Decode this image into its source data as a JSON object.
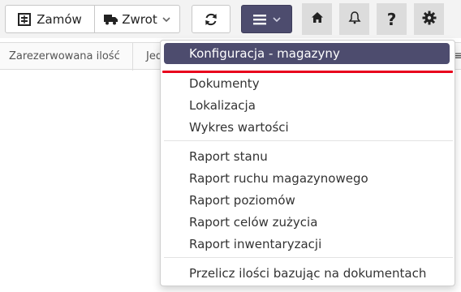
{
  "toolbar": {
    "orders_label": "Zamów",
    "return_label": "Zwrot",
    "help_label": "?"
  },
  "columns": {
    "col1": "Zarezerwowana ilość",
    "col2": "Jed",
    "more": "≡"
  },
  "menu": {
    "active": "Konfiguracja - magazyny",
    "group1": [
      "Dokumenty",
      "Lokalizacja",
      "Wykres wartości"
    ],
    "group2": [
      "Raport stanu",
      "Raport ruchu magazynowego",
      "Raport poziomów",
      "Raport celów zużycia",
      "Raport inwentaryzacji"
    ],
    "group3": [
      "Przelicz ilości bazując na dokumentach"
    ]
  },
  "icons": {
    "orders": "calculator-icon",
    "return": "truck-icon",
    "refresh": "refresh-icon",
    "menu": "hamburger-icon",
    "home": "home-icon",
    "bell": "bell-icon",
    "help": "help-icon",
    "settings": "gear-icon"
  },
  "colors": {
    "accent": "#4d4c6e",
    "highlight": "#e8001c"
  }
}
